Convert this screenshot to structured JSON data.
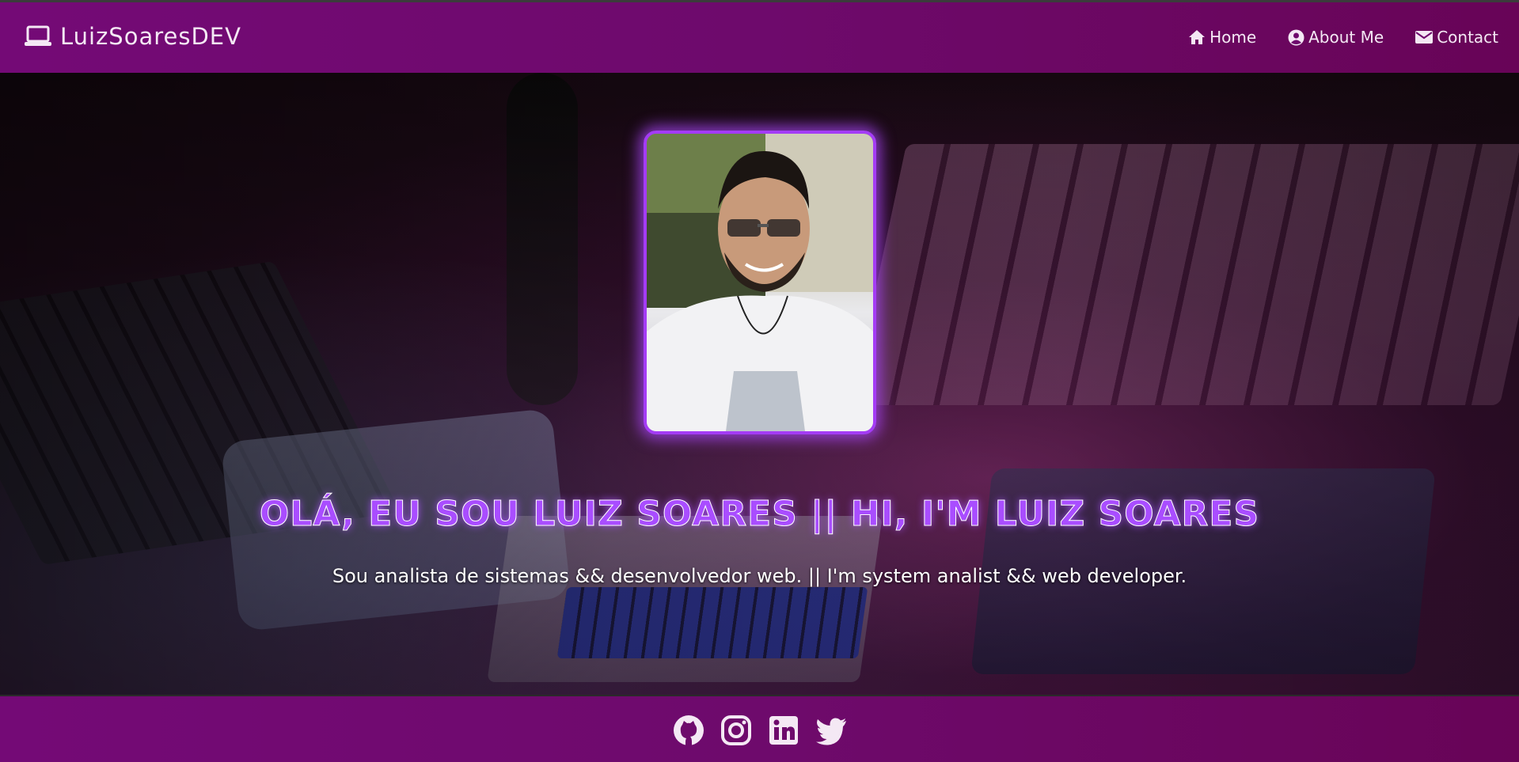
{
  "header": {
    "brand": "LuizSoaresDEV",
    "nav": [
      {
        "label": "Home",
        "icon": "home-icon"
      },
      {
        "label": "About Me",
        "icon": "user-circle-icon"
      },
      {
        "label": "Contact",
        "icon": "envelope-icon"
      }
    ]
  },
  "hero": {
    "headline": "OLÁ, EU SOU LUIZ SOARES || HI, I'M LUIZ SOARES",
    "subline": "Sou analista de sistemas && desenvolvedor web. || I'm system analist && web developer."
  },
  "footer": {
    "socials": [
      "github-icon",
      "instagram-icon",
      "linkedin-icon",
      "twitter-icon"
    ]
  },
  "colors": {
    "bar": "#6e0a6c",
    "accent": "#a94dff",
    "text": "#f4e8f4"
  }
}
